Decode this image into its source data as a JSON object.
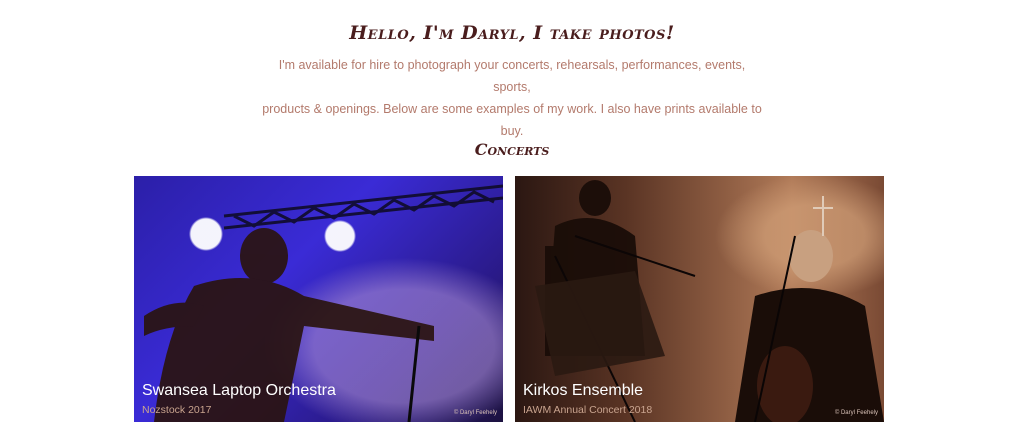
{
  "header": {
    "title": "Hello, I'm Daryl, I take photos!",
    "intro_line1": "I'm available for hire to photograph your concerts, rehearsals, performances, events, sports,",
    "intro_line2": "products & openings. Below are some examples of my work. I also have prints available to buy."
  },
  "section": {
    "title": "Concerts"
  },
  "cards": [
    {
      "title": "Swansea Laptop Orchestra",
      "subtitle": "Nozstock 2017",
      "credit": "© Daryl Feehely"
    },
    {
      "title": "Kirkos Ensemble",
      "subtitle": "IAWM Annual Concert 2018",
      "credit": "© Daryl Feehely"
    }
  ],
  "colors": {
    "heading": "#4a1d1d",
    "body_text": "#b37a6c",
    "background": "#ffffff"
  }
}
